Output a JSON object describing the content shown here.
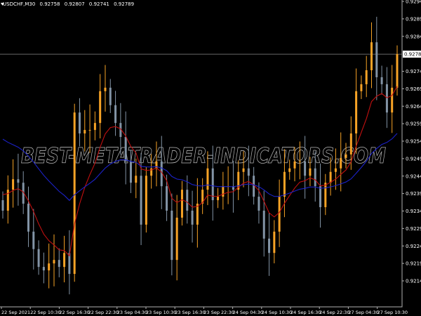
{
  "header": {
    "symbol": "USDCHF,M30",
    "open": "0.92758",
    "high": "0.92807",
    "low": "0.92741",
    "close": "0.92789"
  },
  "watermark": "BEST-METATRADER-INDICATORS.COM",
  "colors": {
    "background": "#000000",
    "bull_candle": "#f7a326",
    "bear_candle": "#8394a6",
    "fast_ma": "#c01010",
    "slow_ma": "#1c22c8",
    "axis": "#b0b0b0",
    "price_line": "#8a8a8a"
  },
  "chart_data": {
    "type": "candlestick",
    "title": "USDCHF,M30",
    "current_price": "0.92789",
    "ylim": [
      0.9212,
      0.9295
    ],
    "y_ticks": [
      "0.92940",
      "0.92890",
      "0.92840",
      "0.92740",
      "0.92690",
      "0.92640",
      "0.92590",
      "0.92540",
      "0.92490",
      "0.92440",
      "0.92390",
      "0.92340",
      "0.92290",
      "0.92240",
      "0.92190",
      "0.92140"
    ],
    "x_ticks": [
      "22 Sep 2021",
      "22 Sep 10:30",
      "22 Sep 16:30",
      "22 Sep 22:30",
      "23 Sep 04:30",
      "23 Sep 10:30",
      "23 Sep 16:30",
      "23 Sep 22:30",
      "24 Sep 04:30",
      "24 Sep 10:30",
      "24 Sep 16:30",
      "24 Sep 22:30",
      "27 Sep 04:30",
      "27 Sep 10:30"
    ],
    "closes": [
      0.92341,
      0.92401,
      0.92431,
      0.92421,
      0.92361,
      0.92281,
      0.92231,
      0.9218,
      0.9217,
      0.9219,
      0.922,
      0.9218,
      0.9222,
      0.9216,
      0.92622,
      0.92562,
      0.92572,
      0.92572,
      0.92592,
      0.92683,
      0.92693,
      0.92643,
      0.92592,
      0.92552,
      0.92482,
      0.92421,
      0.92441,
      0.92301,
      0.92441,
      0.92462,
      0.92482,
      0.92411,
      0.92341,
      0.922,
      0.92321,
      0.92401,
      0.92341,
      0.92301,
      0.92361,
      0.92401,
      0.92462,
      0.92371,
      0.92381,
      0.92411,
      0.92411,
      0.92401,
      0.92452,
      0.92462,
      0.92441,
      0.92381,
      0.92341,
      0.92261,
      0.9222,
      0.92281,
      0.92381,
      0.92452,
      0.92462,
      0.92482,
      0.92482,
      0.92441,
      0.92462,
      0.92411,
      0.92351,
      0.92421,
      0.92452,
      0.92462,
      0.92492,
      0.92502,
      0.92562,
      0.92683,
      0.92703,
      0.92743,
      0.92823,
      0.92723,
      0.92703,
      0.92622,
      0.92693,
      0.92789
    ],
    "series": [
      {
        "type": "moving-average",
        "color": "#c01010"
      },
      {
        "type": "moving-average",
        "color": "#1c22c8"
      }
    ],
    "grid": false
  }
}
